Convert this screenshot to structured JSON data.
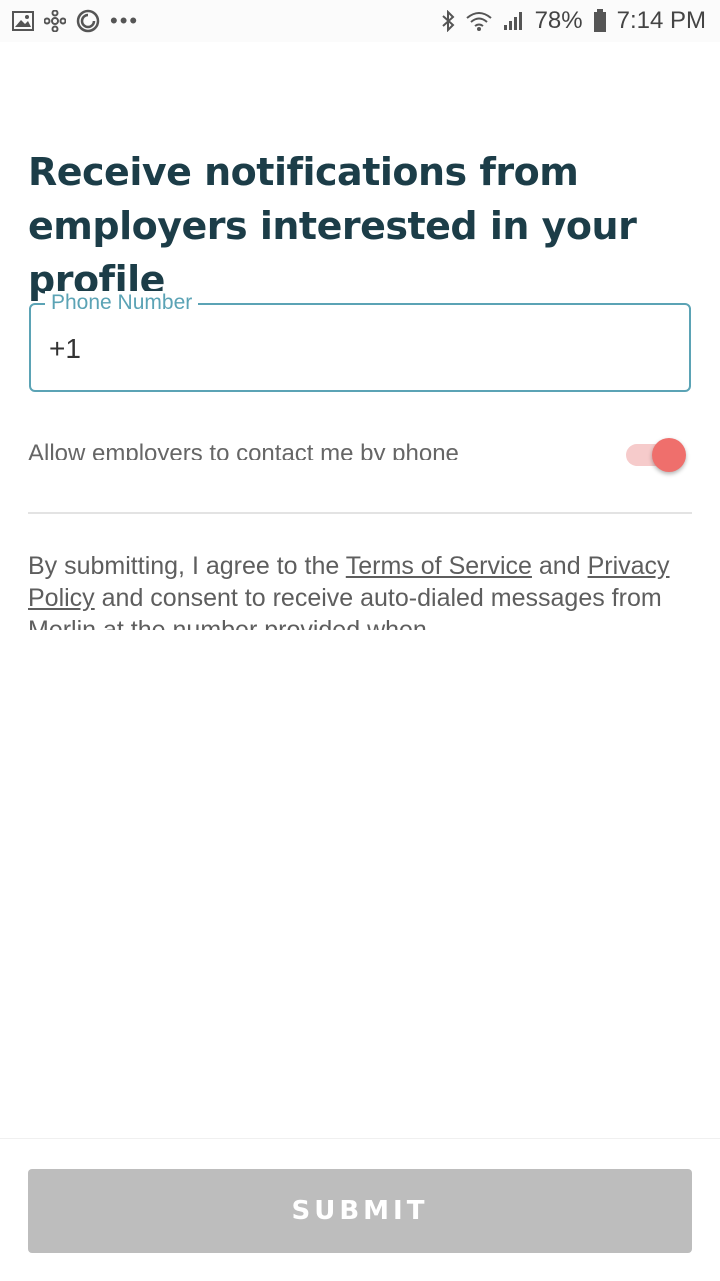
{
  "status_bar": {
    "battery": "78%",
    "time": "7:14 PM",
    "left_icons": [
      "image-icon",
      "pinwheel-icon",
      "sync-icon",
      "more-dots-icon"
    ],
    "right_icons": [
      "bluetooth-icon",
      "wifi-icon",
      "signal-icon",
      "battery-icon"
    ]
  },
  "heading": "Receive notifications from employers interested in your profile",
  "phone_field": {
    "label": "Phone Number",
    "value": "+1"
  },
  "contact_toggle": {
    "label": "Allow employers to contact me by phone",
    "on": true,
    "color": "#ef6f6c"
  },
  "terms": {
    "prefix": "By submitting, I agree to the ",
    "tos_link": "Terms of Service",
    "and": " and ",
    "privacy_link": "Privacy Policy",
    "suffix": " and consent to receive auto-dialed messages from Merlin at the number provided when"
  },
  "submit": {
    "label": "SUBMIT",
    "disabled": true
  },
  "colors": {
    "heading": "#1c3d48",
    "accent": "#5ba3b5",
    "button_disabled": "#bdbdbd"
  }
}
